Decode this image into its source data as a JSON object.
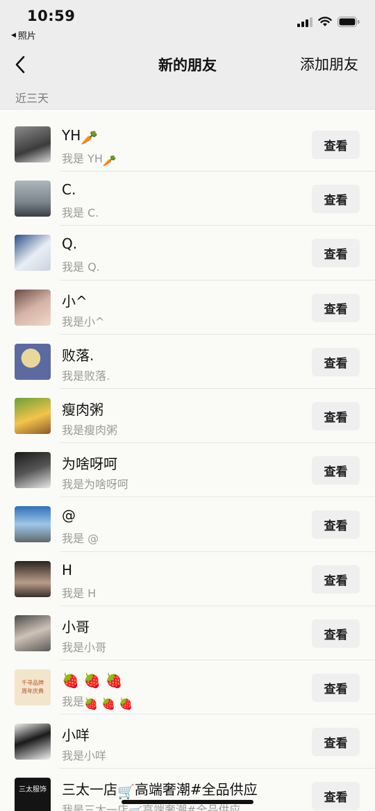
{
  "status_bar": {
    "time": "10:59",
    "back_app": "照片",
    "back_icon": "triangle-left-icon",
    "icons": [
      "signal-icon",
      "wifi-icon",
      "battery-icon"
    ]
  },
  "nav": {
    "back_icon": "chevron-left-icon",
    "title": "新的朋友",
    "add_label": "添加朋友"
  },
  "section": {
    "label": "近三天"
  },
  "view_label": "查看",
  "contacts": [
    {
      "name": "YH",
      "name_emoji": "🥕",
      "msg": "我是 YH",
      "msg_emoji": "🥕",
      "avatar": "photo-person"
    },
    {
      "name": "C.",
      "msg": "我是 C.",
      "avatar": "photo-silhouette"
    },
    {
      "name": "Q.",
      "msg": "我是 Q.",
      "avatar": "photo-snow"
    },
    {
      "name": "小^",
      "msg": "我是小^",
      "avatar": "photo-girl"
    },
    {
      "name": "败落.",
      "msg": "我是败落.",
      "avatar": "photo-moon"
    },
    {
      "name": "瘦肉粥",
      "msg": "我是瘦肉粥",
      "avatar": "photo-cartoon"
    },
    {
      "name": "为啥呀呵",
      "msg": "我是为啥呀呵",
      "avatar": "photo-girl-dark"
    },
    {
      "name": "@",
      "msg": "我是 @",
      "avatar": "photo-car"
    },
    {
      "name": "H",
      "msg": "我是 H",
      "avatar": "photo-boy"
    },
    {
      "name": "小哥",
      "msg": "我是小哥",
      "avatar": "photo-mirror"
    },
    {
      "name": "",
      "name_emoji": "🍓 🍓 🍓",
      "msg": "我是",
      "msg_emoji": "🍓 🍓 🍓",
      "avatar": "logo-text"
    },
    {
      "name": "小咩",
      "msg": "我是小咩",
      "avatar": "photo-anime"
    },
    {
      "name": "三太一店",
      "name_emoji": "🛒",
      "name_suffix": "高端奢潮#全品供应",
      "msg": "我是三太一店",
      "msg_emoji": "🛒",
      "msg_suffix": "高端奢潮#全品供应",
      "avatar": "logo-store"
    }
  ],
  "avatar_text": {
    "strawberry": [
      "千寻品牌",
      "周年庆典"
    ],
    "store": [
      "三太服饰"
    ]
  }
}
